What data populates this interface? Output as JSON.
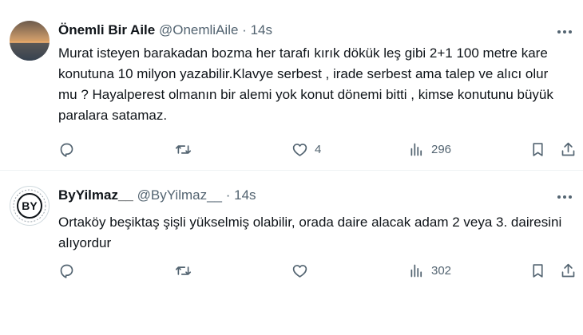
{
  "tweets": [
    {
      "name": "Önemli Bir Aile",
      "handle": "@OnemliAile",
      "dot": "·",
      "time": "14s",
      "text": "Murat isteyen barakadan bozma her tarafı kırık dökük leş gibi 2+1 100 metre kare konutuna  10 milyon yazabilir.Klavye serbest , irade serbest ama talep ve alıcı olur mu ? Hayalperest olmanın bir alemi yok konut dönemi bitti , kimse konutunu büyük paralara satamaz.",
      "like_count": "4",
      "view_count": "296"
    },
    {
      "name": "ByYilmaz__",
      "handle": "@ByYilmaz__",
      "dot": "·",
      "time": "14s",
      "avatar_text": "BY",
      "text": "Ortaköy beşiktaş şişli yükselmiş olabilir, orada daire alacak adam 2 veya 3. dairesini alıyordur",
      "like_count": "",
      "view_count": "302"
    }
  ],
  "icons": [
    "reply-icon",
    "retweet-icon",
    "like-icon",
    "views-icon",
    "bookmark-icon",
    "share-icon",
    "more-icon"
  ],
  "colors": {
    "text": "#0f1419",
    "secondary": "#536471",
    "divider": "#eff3f4"
  }
}
